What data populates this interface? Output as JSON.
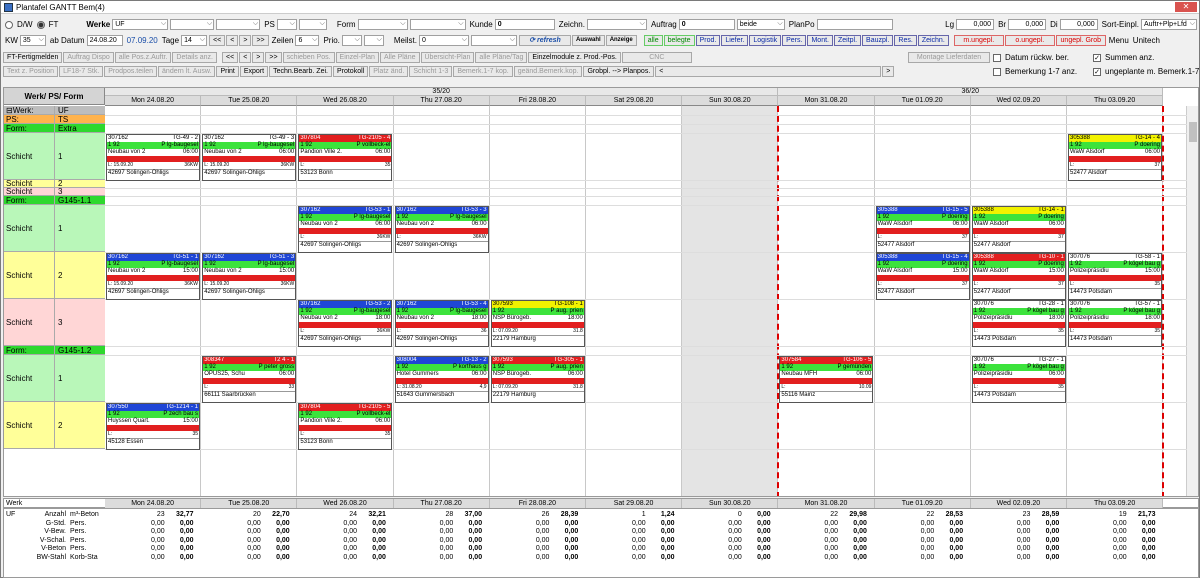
{
  "title": "Plantafel GANTT Bem(4)",
  "toolbar1": {
    "radio1": "D/W",
    "radio2": "FT",
    "werke_label": "Werke",
    "werke_value": "UF",
    "ps_label": "PS",
    "form_label": "Form",
    "kunde_label": "Kunde",
    "kunde_value": "0",
    "zeichn_label": "Zeichn.",
    "auftrag_label": "Auftrag",
    "auftrag_value": "0",
    "beide": "beide",
    "planpo_label": "PlanPo",
    "lg_label": "Lg",
    "lg_value": "0,000",
    "br_label": "Br",
    "br_value": "0,000",
    "di_label": "Di",
    "di_value": "0,000",
    "sort_label": "Sort-Einpl.",
    "sort_value": "Auftr+Plp+Lfd"
  },
  "toolbar2": {
    "kw_label": "KW",
    "kw_value": "35",
    "ab_datum_label": "ab Datum",
    "date_from": "24.08.20",
    "date_to": "07.09.20",
    "tage_label": "Tage",
    "tage_value": "14",
    "zeilen_label": "Zeilen",
    "zeilen_value": "6",
    "prio_label": "Prio.",
    "meilst_label": "Meilst.",
    "meilst_value": "0",
    "refresh": "refresh",
    "auswahl": "Auswahl",
    "anzeige": "Anzeige",
    "buttons": [
      "alle",
      "belegte",
      "Prod.",
      "Liefer.",
      "Logistik",
      "Pers.",
      "Mont.",
      "Zeitpl.",
      "Bauzpl.",
      "Res.",
      "Zeichn."
    ],
    "red_buttons": [
      "m.ungepl.",
      "o.ungepl.",
      "ungepl. Grob"
    ],
    "menu": "Menu",
    "unitech": "Unitech"
  },
  "toolbar3": {
    "row1": [
      "FT-Fertigmelden",
      "Auftrag Dispo",
      "alle Pos.z.Auftr.",
      "Details anz.",
      "<<",
      "<",
      ">",
      ">>",
      "schieben Pos.",
      "Einzel-Plan",
      "Alle Pläne",
      "Übersicht-Plan",
      "alle Pläne/Tag",
      "Einzelmodule z. Prod.-Pos.",
      "CNC",
      "Montage Lieferdaten"
    ],
    "row2": [
      "Text z. Position",
      "LF18-7 Stk.",
      "Prodpos.teilen",
      "ändern lt. Ausw.",
      "Print",
      "Export",
      "Techn.Bearb. Zei.",
      "Protokoll",
      "Platz änd.",
      "Schicht 1-3",
      "Bemerk.1-7 kop.",
      "geänd.Bemerk.kop.",
      "Grobpl. --> Planpos.",
      "<",
      ">"
    ],
    "chk1": "Datum rückw. ber.",
    "chk2": "Summen anz.",
    "chk3": "Bemerkung 1-7 anz.",
    "chk4": "ungeplante m. Bemerk.1-7"
  },
  "grid": {
    "header": "Werk/ PS/ Form",
    "weeks": [
      "35/20",
      "36/20"
    ],
    "days": [
      "Mon 24.08.20",
      "Tue 25.08.20",
      "Wed 26.08.20",
      "Thu 27.08.20",
      "Fri 28.08.20",
      "Sat 29.08.20",
      "Sun 30.08.20",
      "Mon 31.08.20",
      "Tue 01.09.20",
      "Wed 02.09.20",
      "Thu 03.09.20"
    ],
    "rows": [
      {
        "a": "⊟Werk:",
        "b": "UF"
      },
      {
        "a": "PS:",
        "b": "TS"
      },
      {
        "a": "Form:",
        "b": "Extra"
      },
      {
        "a": "Schicht",
        "b": "1"
      },
      {
        "a": "Schicht",
        "b": "2"
      },
      {
        "a": "Schicht",
        "b": "3"
      },
      {
        "a": "Form:",
        "b": "G145-1.1"
      },
      {
        "a": "Schicht",
        "b": "1"
      },
      {
        "a": "Schicht",
        "b": "2"
      },
      {
        "a": "Schicht",
        "b": "3"
      },
      {
        "a": "Form:",
        "b": "G145-1.2"
      },
      {
        "a": "Schicht",
        "b": "1"
      },
      {
        "a": "Schicht",
        "b": "2"
      }
    ],
    "cards": [
      {
        "id": "307162",
        "tg": "TG-49 - 2",
        "pri": "P lg-baugesel",
        "name": "Neubau von 2",
        "time": "06:00",
        "l": "L: 15.09.20",
        "w": "36KW",
        "loc": "42697 Solingen-Ohligs"
      },
      {
        "id": "307162",
        "tg": "TG-49 - 3",
        "pri": "P lg-baugesel",
        "name": "Neubau von 2",
        "time": "06:00",
        "l": "L: 15.09.20",
        "w": "36KW",
        "loc": "42697 Solingen-Ohligs"
      },
      {
        "id": "307804",
        "tg": "TG-2105 - 4",
        "pri": "P vollbeck-el",
        "name": "Pandion Ville 2.",
        "time": "06:00",
        "l": "L:",
        "w": "35",
        "loc": "53123 Bonn"
      },
      {
        "id": "305388",
        "tg": "TG-14 - 4",
        "pri": "P doering",
        "name": "WaW Alsdorf",
        "time": "06:00",
        "l": "L:",
        "w": "37",
        "loc": "52477 Alsdorf"
      },
      {
        "id": "307162",
        "tg": "TG-53 - 1",
        "pri": "P lg-baugesel",
        "name": "Neubau von 2",
        "time": "06:00",
        "l": "L:",
        "w": "36KW",
        "loc": "42697 Solingen-Ohligs"
      },
      {
        "id": "307162",
        "tg": "TG-53 - 3",
        "pri": "P lg-baugesel",
        "name": "Neubau von 2",
        "time": "06:00",
        "l": "L:",
        "w": "36KW",
        "loc": "42697 Solingen-Ohligs"
      },
      {
        "id": "305388",
        "tg": "TG-15 - 5",
        "pri": "P doering",
        "name": "WaW Alsdorf",
        "time": "06:00",
        "l": "L:",
        "w": "37",
        "loc": "52477 Alsdorf"
      },
      {
        "id": "305388",
        "tg": "TG-14 - 1",
        "pri": "P doering",
        "name": "WaW Alsdorf",
        "time": "06:00",
        "l": "L:",
        "w": "37",
        "loc": "52477 Alsdorf"
      },
      {
        "id": "307162",
        "tg": "TG-51 - 1",
        "pri": "P lg-baugesel",
        "name": "Neubau von 2",
        "time": "15:00",
        "l": "L: 15.09.20",
        "w": "36KW",
        "loc": "42697 Solingen-Ohligs"
      },
      {
        "id": "307162",
        "tg": "TG-51 - 3",
        "pri": "P lg-baugesel",
        "name": "Neubau von 2",
        "time": "15:00",
        "l": "L: 15.09.20",
        "w": "36KW",
        "loc": "42697 Solingen-Ohligs"
      },
      {
        "id": "305388",
        "tg": "TG-15 - 4",
        "pri": "P doering",
        "name": "WaW Alsdorf",
        "time": "15:00",
        "l": "L:",
        "w": "37",
        "loc": "52477 Alsdorf"
      },
      {
        "id": "305388",
        "tg": "TG-10 - 1",
        "pri": "P doering",
        "name": "WaW Alsdorf",
        "time": "15:00",
        "l": "L:",
        "w": "37",
        "loc": "52477 Alsdorf"
      },
      {
        "id": "307076",
        "tg": "TG-58 - 1",
        "pri": "P kögel bau g",
        "name": "Polizeipräsidiu",
        "time": "15:00",
        "l": "L:",
        "w": "35",
        "loc": "14473 Potsdam"
      },
      {
        "id": "307162",
        "tg": "TG-53 - 2",
        "pri": "P lg-baugesel",
        "name": "Neubau von 2",
        "time": "18:00",
        "l": "L:",
        "w": "36KW",
        "loc": "42697 Solingen-Ohligs"
      },
      {
        "id": "307162",
        "tg": "TG-53 - 4",
        "pri": "P lg-baugesel",
        "name": "Neubau von 2",
        "time": "18:00",
        "l": "L:",
        "w": "36",
        "loc": "42697 Solingen-Ohligs"
      },
      {
        "id": "307593",
        "tg": "TG-108 - 1",
        "pri": "P aug. prien",
        "name": "NSP Bürogeb.",
        "time": "18:00",
        "l": "L: 07.09.20",
        "w": "31.8",
        "loc": "22179 Hamburg"
      },
      {
        "id": "307076",
        "tg": "TG-28 - 1",
        "pri": "P kögel bau g",
        "name": "Polizeipräsidiu",
        "time": "18:00",
        "l": "L:",
        "w": "35",
        "loc": "14473 Potsdam"
      },
      {
        "id": "307076",
        "tg": "TG-57 - 1",
        "pri": "P kögel bau g",
        "name": "Polizeipräsidiu",
        "time": "18:00",
        "l": "L:",
        "w": "35",
        "loc": "14473 Potsdam"
      },
      {
        "id": "308347",
        "tg": "T2 4 - 1",
        "pri": "P peter gross",
        "name": "OPUS25, Schu",
        "time": "06:00",
        "l": "L:",
        "w": "33",
        "loc": "66111 Saarbrücken"
      },
      {
        "id": "308004",
        "tg": "TG-13 - 2",
        "pri": "P korthaus g",
        "name": "Hotel Gummers",
        "time": "06:00",
        "l": "L: 31.08.20",
        "w": "4,9",
        "loc": "51643 Gummersbach"
      },
      {
        "id": "307593",
        "tg": "TG-305 - 1",
        "pri": "P aug. prien",
        "name": "NSP Bürogeb.",
        "time": "06:00",
        "l": "L: 07.09.20",
        "w": "31.8",
        "loc": "22179 Hamburg"
      },
      {
        "id": "307584",
        "tg": "TG-106 - 5",
        "pri": "P gemünden",
        "name": "Neubau MFH",
        "time": "06:00",
        "l": "L:",
        "w": "10.09",
        "loc": "55116 Mainz"
      },
      {
        "id": "307076",
        "tg": "TG-27 - 1",
        "pri": "P kögel bau g",
        "name": "Polizeipräsidiu",
        "time": "06:00",
        "l": "L:",
        "w": "35",
        "loc": "14473 Potsdam"
      },
      {
        "id": "307550",
        "tg": "TG-1214 - 1",
        "pri": "P zech bau s",
        "name": "Huyssen Quart.",
        "time": "15:00",
        "l": "L:",
        "w": "35",
        "loc": "45128 Essen"
      },
      {
        "id": "307804",
        "tg": "TG-2105 - 5",
        "pri": "P vollbeck-el",
        "name": "Pandion Ville 2.",
        "time": "06:00",
        "l": "L:",
        "w": "35",
        "loc": "53123 Bonn"
      }
    ]
  },
  "summary": {
    "werk_label": "Werk",
    "werk_value": "UF",
    "labels": [
      [
        "Anzahl",
        "m³-Beton"
      ],
      [
        "G-Std.",
        "Pers."
      ],
      [
        "V-Bew.",
        "Pers."
      ],
      [
        "V-Schal.",
        "Pers."
      ],
      [
        "V-Beton",
        "Pers."
      ],
      [
        "BW-Stahl",
        "Korb-Sta"
      ]
    ],
    "days": [
      "Mon 24.08.20",
      "Tue 25.08.20",
      "Wed 26.08.20",
      "Thu 27.08.20",
      "Fri 28.08.20",
      "Sat 29.08.20",
      "Sun 30.08.20",
      "Mon 31.08.20",
      "Tue 01.09.20",
      "Wed 02.09.20",
      "Thu 03.09.20"
    ],
    "values": [
      [
        [
          "23",
          "32,77"
        ],
        [
          "0,00",
          "0,00"
        ],
        [
          "0,00",
          "0,00"
        ],
        [
          "0,00",
          "0,00"
        ],
        [
          "0,00",
          "0,00"
        ],
        [
          "0,00",
          "0,00"
        ]
      ],
      [
        [
          "20",
          "22,70"
        ],
        [
          "0,00",
          "0,00"
        ],
        [
          "0,00",
          "0,00"
        ],
        [
          "0,00",
          "0,00"
        ],
        [
          "0,00",
          "0,00"
        ],
        [
          "0,00",
          "0,00"
        ]
      ],
      [
        [
          "24",
          "32,21"
        ],
        [
          "0,00",
          "0,00"
        ],
        [
          "0,00",
          "0,00"
        ],
        [
          "0,00",
          "0,00"
        ],
        [
          "0,00",
          "0,00"
        ],
        [
          "0,00",
          "0,00"
        ]
      ],
      [
        [
          "28",
          "37,00"
        ],
        [
          "0,00",
          "0,00"
        ],
        [
          "0,00",
          "0,00"
        ],
        [
          "0,00",
          "0,00"
        ],
        [
          "0,00",
          "0,00"
        ],
        [
          "0,00",
          "0,00"
        ]
      ],
      [
        [
          "26",
          "28,39"
        ],
        [
          "0,00",
          "0,00"
        ],
        [
          "0,00",
          "0,00"
        ],
        [
          "0,00",
          "0,00"
        ],
        [
          "0,00",
          "0,00"
        ],
        [
          "0,00",
          "0,00"
        ]
      ],
      [
        [
          "1",
          "1,24"
        ],
        [
          "0,00",
          "0,00"
        ],
        [
          "0,00",
          "0,00"
        ],
        [
          "0,00",
          "0,00"
        ],
        [
          "0,00",
          "0,00"
        ],
        [
          "0,00",
          "0,00"
        ]
      ],
      [
        [
          "0",
          "0,00"
        ],
        [
          "0,00",
          "0,00"
        ],
        [
          "0,00",
          "0,00"
        ],
        [
          "0,00",
          "0,00"
        ],
        [
          "0,00",
          "0,00"
        ],
        [
          "0,00",
          "0,00"
        ]
      ],
      [
        [
          "22",
          "29,98"
        ],
        [
          "0,00",
          "0,00"
        ],
        [
          "0,00",
          "0,00"
        ],
        [
          "0,00",
          "0,00"
        ],
        [
          "0,00",
          "0,00"
        ],
        [
          "0,00",
          "0,00"
        ]
      ],
      [
        [
          "22",
          "28,53"
        ],
        [
          "0,00",
          "0,00"
        ],
        [
          "0,00",
          "0,00"
        ],
        [
          "0,00",
          "0,00"
        ],
        [
          "0,00",
          "0,00"
        ],
        [
          "0,00",
          "0,00"
        ]
      ],
      [
        [
          "23",
          "28,59"
        ],
        [
          "0,00",
          "0,00"
        ],
        [
          "0,00",
          "0,00"
        ],
        [
          "0,00",
          "0,00"
        ],
        [
          "0,00",
          "0,00"
        ],
        [
          "0,00",
          "0,00"
        ]
      ],
      [
        [
          "19",
          "21,73"
        ],
        [
          "0,00",
          "0,00"
        ],
        [
          "0,00",
          "0,00"
        ],
        [
          "0,00",
          "0,00"
        ],
        [
          "0,00",
          "0,00"
        ],
        [
          "0,00",
          "0,00"
        ]
      ]
    ]
  },
  "colors": {
    "extra_green": "#2ed82e",
    "form_green": "#2ed82e",
    "ps_orange": "#ffb34d",
    "werk_gray": "#bdbdbd",
    "schicht1_green": "#b9f7b9",
    "schicht2_yellow": "#ffff99",
    "schicht3_pink": "#ffd6d6",
    "card_hdr_blue": "#1f46d6",
    "card_hdr_red": "#e21f1f",
    "card_hdr_yellow": "#f2f200",
    "card_hdr_white": "#ffffff",
    "today_line": "#dd0000"
  }
}
